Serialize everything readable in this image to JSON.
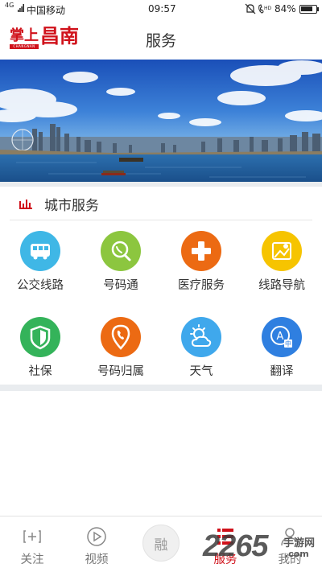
{
  "status_bar": {
    "network": "4G",
    "carrier": "中国移动",
    "time": "09:57",
    "battery_text": "84%",
    "battery_level": 0.84
  },
  "header": {
    "logo_small": "掌上",
    "logo_big": "昌南",
    "logo_sub": "CHANGNAN",
    "title": "服务"
  },
  "section": {
    "title": "城市服务",
    "accent": "#d0121b"
  },
  "services": [
    {
      "label": "公交线路",
      "icon": "bus-icon",
      "color": "#3fb7e6"
    },
    {
      "label": "号码通",
      "icon": "phone-search-icon",
      "color": "#8cc63f"
    },
    {
      "label": "医疗服务",
      "icon": "medical-cross-icon",
      "color": "#ec6a13"
    },
    {
      "label": "线路导航",
      "icon": "map-navigation-icon",
      "color": "#f6c400"
    },
    {
      "label": "社保",
      "icon": "shield-icon",
      "color": "#34b35a"
    },
    {
      "label": "号码归属",
      "icon": "phone-location-icon",
      "color": "#ec6a13"
    },
    {
      "label": "天气",
      "icon": "weather-icon",
      "color": "#3fa8ec"
    },
    {
      "label": "翻译",
      "icon": "translate-icon",
      "color": "#2f7fe0"
    }
  ],
  "tabs": [
    {
      "label": "关注",
      "icon": "follow-icon"
    },
    {
      "label": "视频",
      "icon": "video-icon"
    },
    {
      "label": "融",
      "icon": "center-rong"
    },
    {
      "label": "服务",
      "icon": "service-icon"
    },
    {
      "label": "我的",
      "icon": "user-icon"
    }
  ],
  "active_tab": "服务",
  "watermark": {
    "digits": "2265",
    "site": "手游网",
    "suffix": ".com"
  }
}
